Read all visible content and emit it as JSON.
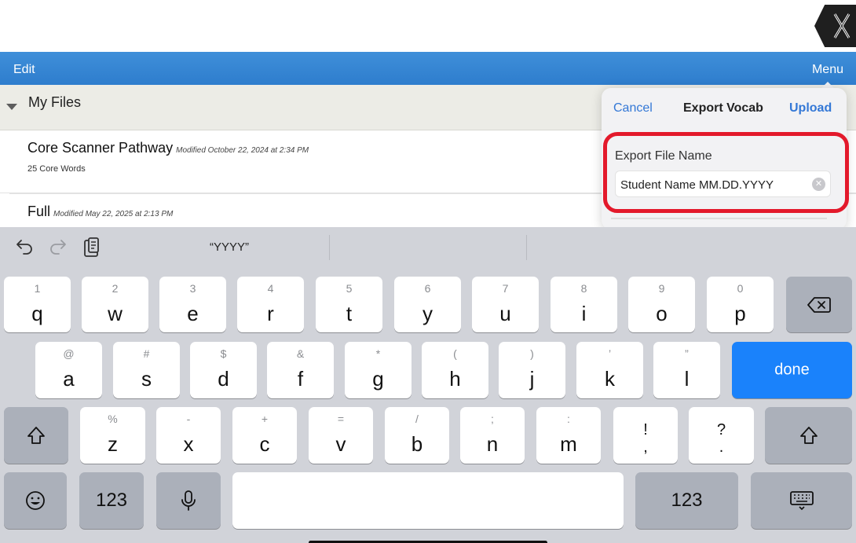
{
  "toolbar": {
    "edit_label": "Edit",
    "menu_label": "Menu"
  },
  "section": {
    "title": "My Files"
  },
  "files": [
    {
      "name": "Core Scanner Pathway",
      "modified": "Modified October 22, 2024 at 2:34 PM",
      "subtitle": "25 Core Words"
    },
    {
      "name": "Full",
      "modified": "Modified May 22, 2025 at 2:13 PM"
    }
  ],
  "popover": {
    "cancel_label": "Cancel",
    "title": "Export Vocab",
    "upload_label": "Upload",
    "field_label": "Export File Name",
    "field_value": "Student Name MM.DD.YYYY",
    "highlight_color": "#e3192b"
  },
  "keyboard": {
    "suggestion": "“YYYY”",
    "row1": [
      {
        "hint": "1",
        "key": "q"
      },
      {
        "hint": "2",
        "key": "w"
      },
      {
        "hint": "3",
        "key": "e"
      },
      {
        "hint": "4",
        "key": "r"
      },
      {
        "hint": "5",
        "key": "t"
      },
      {
        "hint": "6",
        "key": "y"
      },
      {
        "hint": "7",
        "key": "u"
      },
      {
        "hint": "8",
        "key": "i"
      },
      {
        "hint": "9",
        "key": "o"
      },
      {
        "hint": "0",
        "key": "p"
      }
    ],
    "row2": [
      {
        "hint": "@",
        "key": "a"
      },
      {
        "hint": "#",
        "key": "s"
      },
      {
        "hint": "$",
        "key": "d"
      },
      {
        "hint": "&",
        "key": "f"
      },
      {
        "hint": "*",
        "key": "g"
      },
      {
        "hint": "(",
        "key": "h"
      },
      {
        "hint": ")",
        "key": "j"
      },
      {
        "hint": "’",
        "key": "k"
      },
      {
        "hint": "”",
        "key": "l"
      }
    ],
    "done_label": "done",
    "row3": [
      {
        "hint": "%",
        "key": "z"
      },
      {
        "hint": "-",
        "key": "x"
      },
      {
        "hint": "+",
        "key": "c"
      },
      {
        "hint": "=",
        "key": "v"
      },
      {
        "hint": "/",
        "key": "b"
      },
      {
        "hint": ";",
        "key": "n"
      },
      {
        "hint": ":",
        "key": "m"
      }
    ],
    "punct1": {
      "top": "!",
      "bottom": ","
    },
    "punct2": {
      "top": "?",
      "bottom": "."
    },
    "numbers_label": "123",
    "accent_color": "#1a82fb"
  }
}
